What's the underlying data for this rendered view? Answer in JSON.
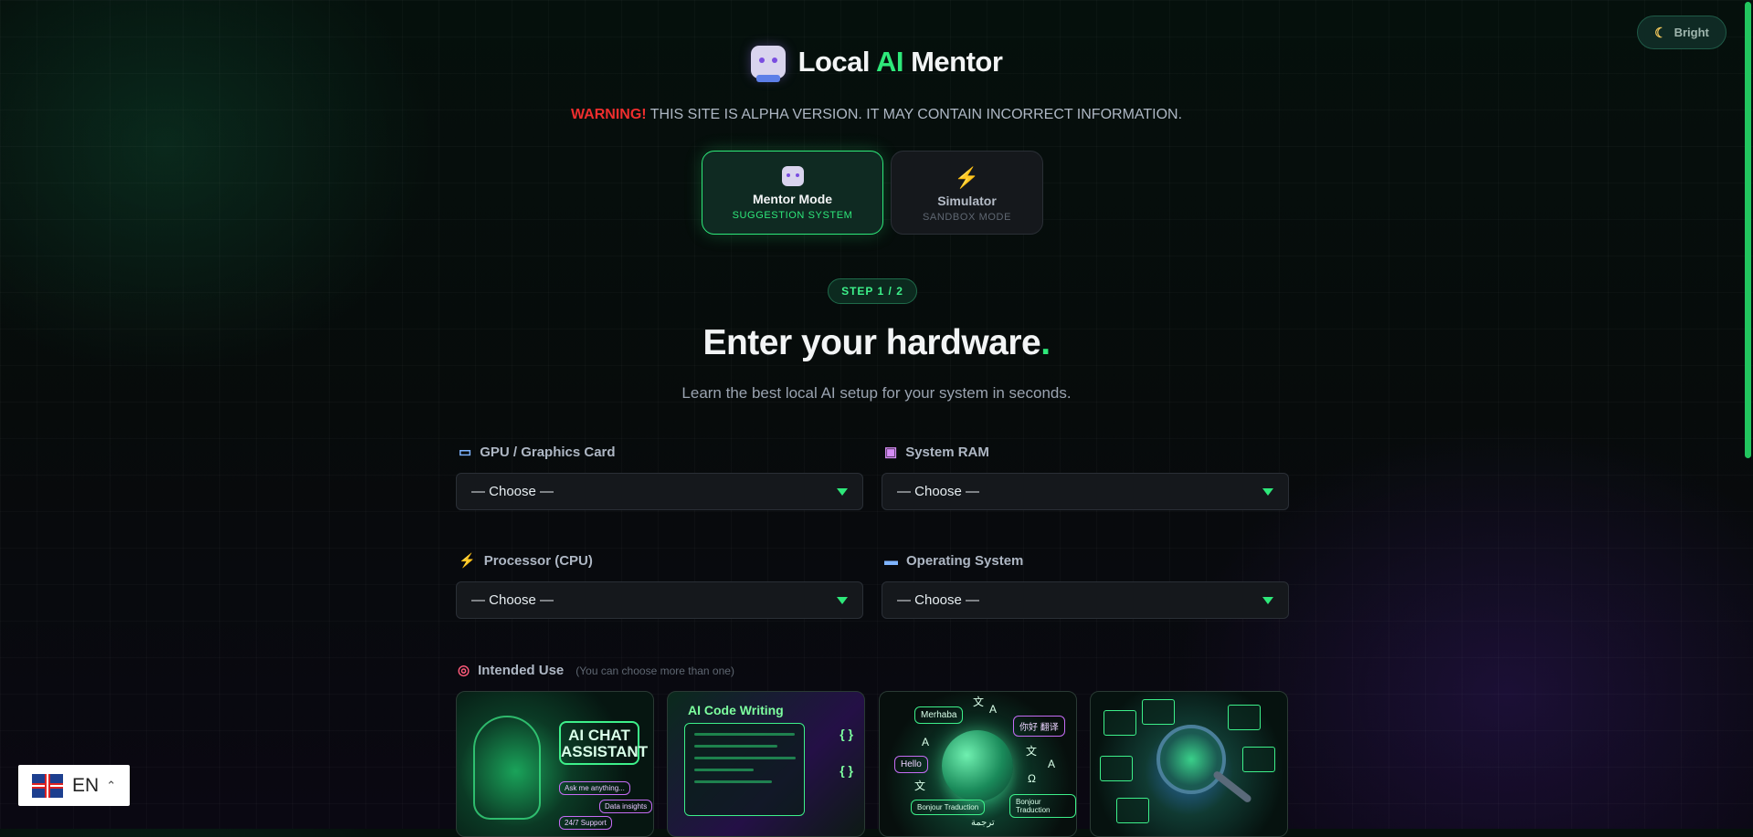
{
  "theme_toggle": {
    "label": "Bright",
    "icon": "moon-icon"
  },
  "brand": {
    "prefix": "Local ",
    "highlight": "AI",
    "suffix": " Mentor",
    "accent_color": "#2ee87a"
  },
  "warning": {
    "label": "WARNING!",
    "text": " THIS SITE IS ALPHA VERSION. IT MAY CONTAIN INCORRECT INFORMATION."
  },
  "modes": [
    {
      "title": "Mentor Mode",
      "subtitle": "SUGGESTION SYSTEM",
      "icon": "robot-icon",
      "active": true
    },
    {
      "title": "Simulator",
      "subtitle": "SANDBOX MODE",
      "icon": "lightning-icon",
      "active": false
    }
  ],
  "step": "STEP 1 / 2",
  "hero": {
    "title": "Enter your hardware",
    "title_dot": ".",
    "subtitle": "Learn the best local AI setup for your system in seconds."
  },
  "fields": {
    "gpu": {
      "label": "GPU / Graphics Card",
      "icon": "monitor-icon",
      "value": "— Choose —"
    },
    "ram": {
      "label": "System RAM",
      "icon": "floppy-disk-icon",
      "value": "— Choose —"
    },
    "cpu": {
      "label": "Processor (CPU)",
      "icon": "lightning-icon",
      "value": "— Choose —"
    },
    "os": {
      "label": "Operating System",
      "icon": "laptop-icon",
      "value": "— Choose —"
    }
  },
  "intended_use": {
    "label": "Intended Use",
    "hint": "(You can choose more than one)",
    "icon": "target-icon",
    "cards": [
      {
        "name": "ai-chat-assistant",
        "line1": "AI CHAT",
        "line2": "ASSISTANT",
        "pill1": "Ask me anything...",
        "pill2": "Data insights",
        "pill3": "24/7 Support"
      },
      {
        "name": "ai-code-writing",
        "title": "AI Code Writing",
        "brace": "{ }"
      },
      {
        "name": "translation",
        "b1": "Merhaba",
        "b2": "你好 翻译",
        "b3": "Hello",
        "b4": "Bonjour Traduction",
        "b5": "Bonjour Traduction",
        "g1": "文",
        "g2": "A",
        "g3": "Ω",
        "g4": "ترجمة"
      },
      {
        "name": "data-analysis"
      }
    ]
  },
  "language": {
    "code": "EN",
    "icon": "uk-flag-icon"
  }
}
